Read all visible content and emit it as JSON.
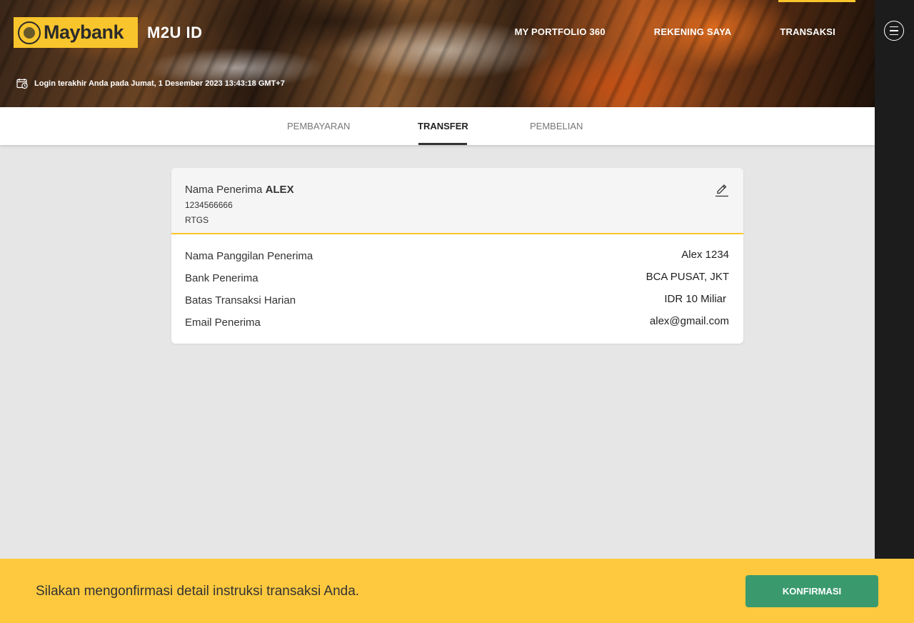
{
  "header": {
    "brand_name": "Maybank",
    "product_name": "M2U ID",
    "nav": [
      {
        "label": "MY PORTFOLIO 360"
      },
      {
        "label": "REKENING SAYA"
      },
      {
        "label": "TRANSAKSI"
      }
    ],
    "active_nav": "TRANSAKSI",
    "last_login": "Login terakhir Anda pada Jumat, 1 Desember 2023 13:43:18 GMT+7"
  },
  "tabs": [
    {
      "label": "PEMBAYARAN"
    },
    {
      "label": "TRANSFER"
    },
    {
      "label": "PEMBELIAN"
    }
  ],
  "active_tab": "TRANSFER",
  "recipient": {
    "title_prefix": "Nama Penerima",
    "name": "ALEX",
    "account_number": "1234566666",
    "method": "RTGS"
  },
  "details": [
    {
      "label": "Nama Panggilan Penerima",
      "value": "Alex 1234"
    },
    {
      "label": "Bank Penerima",
      "value": "BCA PUSAT, JKT"
    },
    {
      "label": "Batas Transaksi Harian",
      "value": "IDR 10 Miliar"
    },
    {
      "label": "Email Penerima",
      "value": "alex@gmail.com"
    }
  ],
  "footer": {
    "message": "Silakan mengonfirmasi detail instruksi transaksi Anda.",
    "confirm_label": "KONFIRMASI"
  },
  "colors": {
    "brand_yellow": "#f9c52c",
    "footer_yellow": "#fec93e",
    "confirm_green": "#3a9a6e",
    "rail_dark": "#1c1c1c"
  },
  "icons": {
    "menu": "hamburger-menu-icon",
    "edit": "pencil-edit-icon",
    "login": "calendar-clock-icon"
  }
}
